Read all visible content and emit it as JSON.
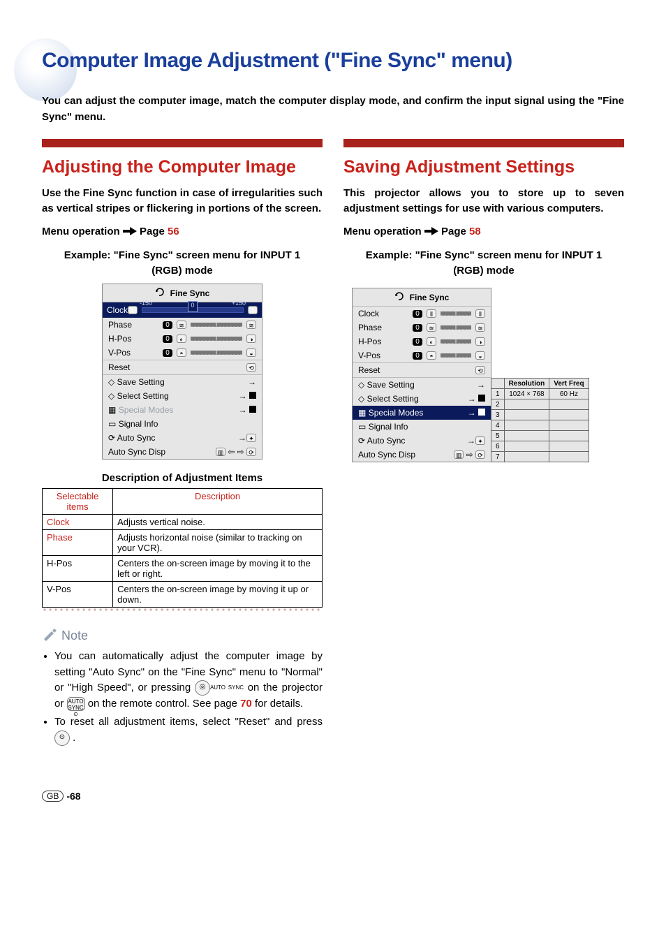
{
  "title": "Computer Image Adjustment (\"Fine Sync\" menu)",
  "intro": "You can adjust the computer image, match the computer display mode, and confirm the input signal using the \"Fine Sync\" menu.",
  "left": {
    "heading": "Adjusting the Computer Image",
    "para": "Use the Fine Sync function in case of irregularities such as vertical stripes or flickering in portions of the screen.",
    "menu_op_label": "Menu operation",
    "menu_op_page_label": "Page",
    "menu_op_page_num": "56",
    "example_caption": "Example: \"Fine Sync\" screen menu for INPUT 1 (RGB) mode",
    "table_caption": "Description of Adjustment Items",
    "table": {
      "headers": [
        "Selectable items",
        "Description"
      ],
      "rows": [
        {
          "item": "Clock",
          "desc": "Adjusts vertical noise.",
          "highlight": true
        },
        {
          "item": "Phase",
          "desc": "Adjusts horizontal noise (similar to tracking on your VCR).",
          "highlight": true
        },
        {
          "item": "H-Pos",
          "desc": "Centers the on-screen image by moving it to the left or right.",
          "highlight": false
        },
        {
          "item": "V-Pos",
          "desc": "Centers the on-screen image by moving it up or down.",
          "highlight": false
        }
      ]
    },
    "note_label": "Note",
    "notes": [
      {
        "pre": "You can automatically adjust the computer image by setting \"Auto Sync\" on the \"Fine Sync\" menu to \"Normal\" or \"High Speed\", or pressing ",
        "btn1_label": "AUTO SYNC",
        "mid": " on the projector or ",
        "btn2_label": "AUTO SYNC",
        "post1": " on the remote control. See page ",
        "page_num": "70",
        "post2": " for details."
      },
      {
        "pre": "To reset all adjustment items, select \"Reset\" and press ",
        "btn1_label": "ENTER",
        "post2": "."
      }
    ]
  },
  "right": {
    "heading": "Saving Adjustment Settings",
    "para": "This projector allows you to store up to seven adjustment settings for use with various computers.",
    "menu_op_label": "Menu operation",
    "menu_op_page_label": "Page",
    "menu_op_page_num": "58",
    "example_caption": "Example: \"Fine Sync\" screen menu for INPUT 1 (RGB) mode",
    "res_table": {
      "headers": [
        "",
        "Resolution",
        "Vert Freq"
      ],
      "rows": [
        [
          "1",
          "1024 × 768",
          "60 Hz"
        ],
        [
          "2",
          "",
          ""
        ],
        [
          "3",
          "",
          ""
        ],
        [
          "4",
          "",
          ""
        ],
        [
          "5",
          "",
          ""
        ],
        [
          "6",
          "",
          ""
        ],
        [
          "7",
          "",
          ""
        ]
      ]
    }
  },
  "osd": {
    "title": "Fine Sync",
    "selected": "Clock",
    "zero": "0",
    "value": "0",
    "params": [
      "Phase",
      "H-Pos",
      "V-Pos"
    ],
    "reset": "Reset",
    "save_setting": "Save Setting",
    "select_setting": "Select Setting",
    "special_modes": "Special Modes",
    "signal_info": "Signal Info",
    "auto_sync": "Auto Sync",
    "auto_sync_disp": "Auto Sync Disp"
  },
  "osd2": {
    "params_top": [
      "Clock",
      "Phase",
      "H-Pos",
      "V-Pos"
    ]
  },
  "footer": {
    "gb": "GB",
    "page": "-68"
  },
  "colors": {
    "accent_red": "#c8221b",
    "title_blue": "#1a3f9c"
  }
}
